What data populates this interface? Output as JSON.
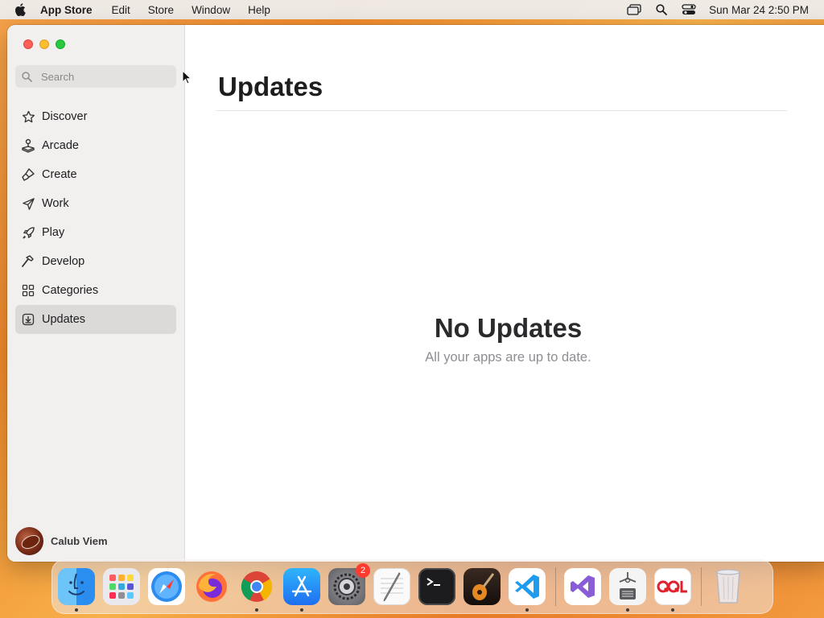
{
  "menubar": {
    "app_name": "App Store",
    "menus": [
      "Edit",
      "Store",
      "Window",
      "Help"
    ],
    "clock": "Sun Mar 24  2:50 PM",
    "status_icons": [
      "screen-mirroring-icon",
      "spotlight-search-icon",
      "control-center-icon"
    ]
  },
  "window": {
    "search": {
      "placeholder": "Search"
    },
    "sidebar": {
      "items": [
        {
          "label": "Discover",
          "icon": "star-icon"
        },
        {
          "label": "Arcade",
          "icon": "joystick-icon"
        },
        {
          "label": "Create",
          "icon": "brush-icon"
        },
        {
          "label": "Work",
          "icon": "paper-plane-icon"
        },
        {
          "label": "Play",
          "icon": "rocket-icon"
        },
        {
          "label": "Develop",
          "icon": "hammer-icon"
        },
        {
          "label": "Categories",
          "icon": "grid-icon"
        },
        {
          "label": "Updates",
          "icon": "download-icon",
          "selected": true
        }
      ]
    },
    "profile": {
      "name": "Calub Viem"
    },
    "main": {
      "title": "Updates",
      "empty_title": "No Updates",
      "empty_subtitle": "All your apps are up to date."
    }
  },
  "dock": {
    "apps": [
      {
        "name": "Finder",
        "running": true
      },
      {
        "name": "Launchpad",
        "running": false
      },
      {
        "name": "Safari",
        "running": false
      },
      {
        "name": "Firefox",
        "running": false
      },
      {
        "name": "Chrome",
        "running": true
      },
      {
        "name": "App Store",
        "running": true
      },
      {
        "name": "System Settings",
        "running": false,
        "badge": "2"
      },
      {
        "name": "TextEdit",
        "running": false
      },
      {
        "name": "Terminal",
        "running": false
      },
      {
        "name": "GarageBand",
        "running": false
      },
      {
        "name": "Visual Studio Code",
        "running": true
      },
      {
        "name": "Visual Studio",
        "running": false
      },
      {
        "name": "System Information",
        "running": true
      },
      {
        "name": "QQL",
        "running": true
      },
      {
        "name": "Trash",
        "running": false
      }
    ]
  }
}
